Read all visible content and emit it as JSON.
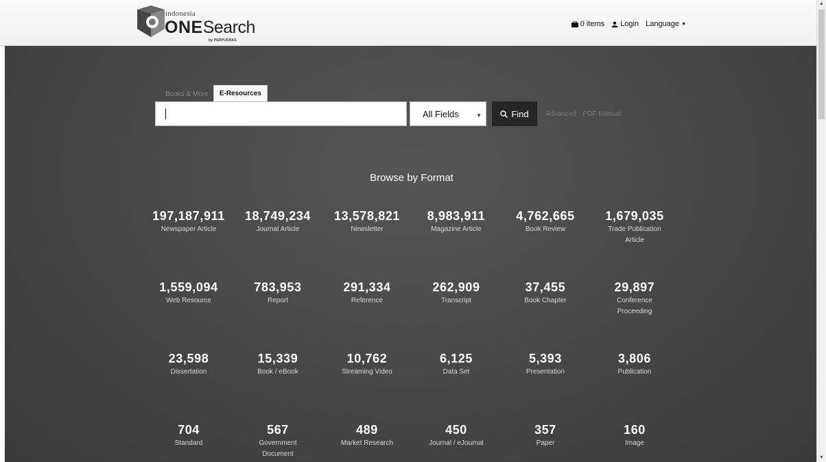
{
  "header": {
    "logo": {
      "small": "indonesia",
      "main_bold": "ONE",
      "main_rest": "Search",
      "by": "by PERPUSNAS"
    },
    "nav": {
      "items_label": "0 items",
      "login_label": "Login",
      "language_label": "Language"
    }
  },
  "search": {
    "tabs": [
      {
        "label": "Books & More",
        "active": false
      },
      {
        "label": "E-Resources",
        "active": true
      }
    ],
    "query": "",
    "field_select": "All Fields",
    "find_label": "Find",
    "advanced_label": "Advanced",
    "manual_label": "PDF Manual"
  },
  "browse": {
    "title": "Browse by Format",
    "formats": [
      {
        "count": "197,187,911",
        "label": "Newspaper Article"
      },
      {
        "count": "18,749,234",
        "label": "Journal Article"
      },
      {
        "count": "13,578,821",
        "label": "Newsletter"
      },
      {
        "count": "8,983,911",
        "label": "Magazine Article"
      },
      {
        "count": "4,762,665",
        "label": "Book Review"
      },
      {
        "count": "1,679,035",
        "label": "Trade Publication Article"
      },
      {
        "count": "1,559,094",
        "label": "Web Resource"
      },
      {
        "count": "783,953",
        "label": "Report"
      },
      {
        "count": "291,334",
        "label": "Reference"
      },
      {
        "count": "262,909",
        "label": "Transcript"
      },
      {
        "count": "37,455",
        "label": "Book Chapter"
      },
      {
        "count": "29,897",
        "label": "Conference Proceeding"
      },
      {
        "count": "23,598",
        "label": "Dissertation"
      },
      {
        "count": "15,339",
        "label": "Book / eBook"
      },
      {
        "count": "10,762",
        "label": "Streaming Video"
      },
      {
        "count": "6,125",
        "label": "Data Set"
      },
      {
        "count": "5,393",
        "label": "Presentation"
      },
      {
        "count": "3,806",
        "label": "Publication"
      },
      {
        "count": "704",
        "label": "Standard"
      },
      {
        "count": "567",
        "label": "Government Document"
      },
      {
        "count": "489",
        "label": "Market Research"
      },
      {
        "count": "450",
        "label": "Journal / eJournal"
      },
      {
        "count": "357",
        "label": "Paper"
      },
      {
        "count": "160",
        "label": "Image"
      }
    ]
  }
}
